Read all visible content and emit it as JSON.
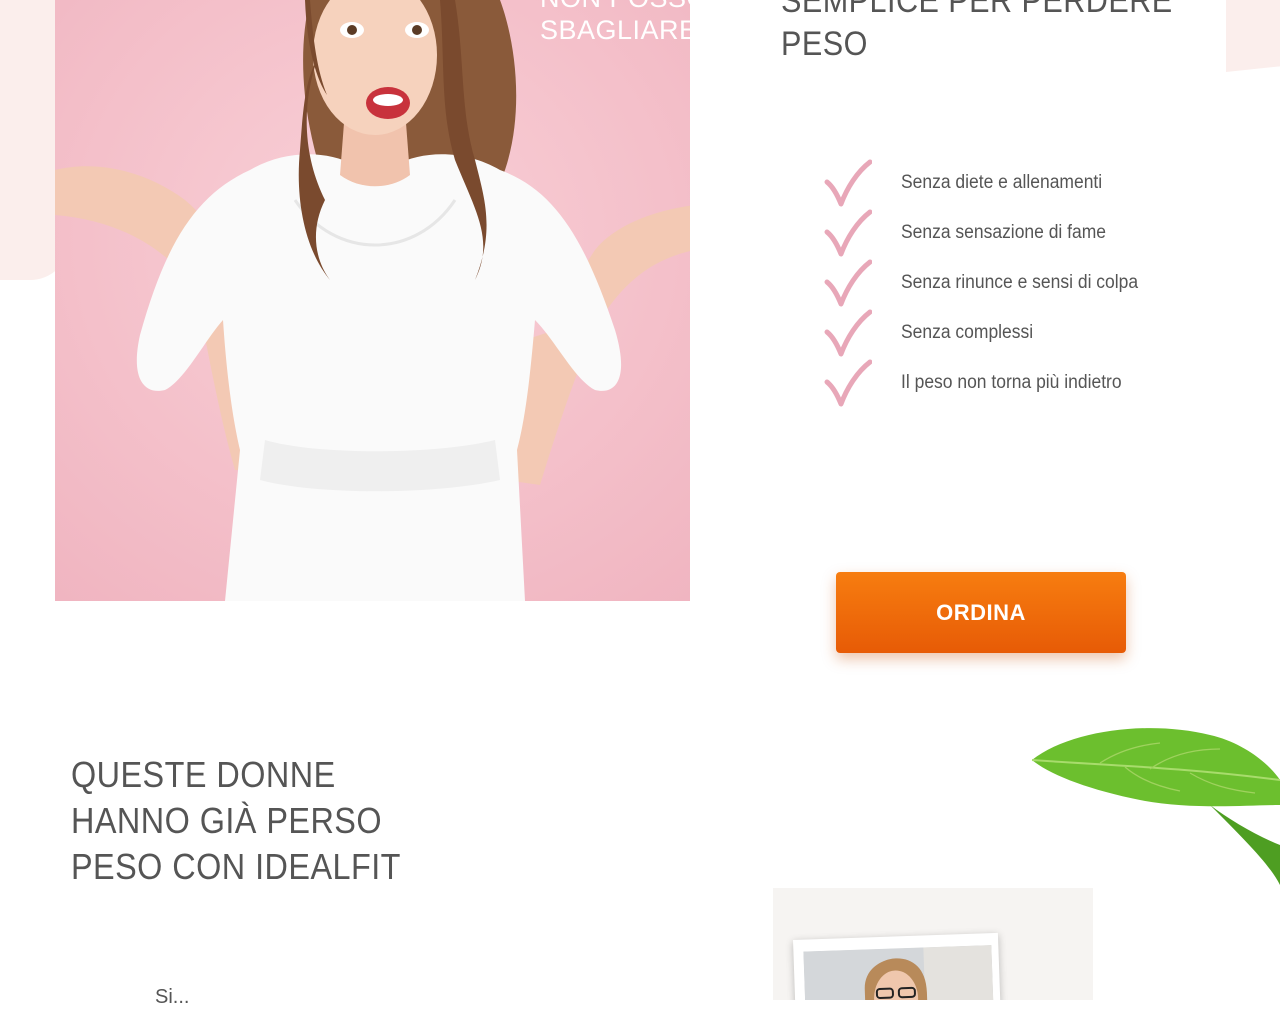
{
  "hero": {
    "overlay_line1": "NON POSSONO",
    "overlay_line2": "SBAGLIARE!"
  },
  "heading1": {
    "line1": "SEMPLICE PER PERDERE",
    "line2": "PESO"
  },
  "benefits": [
    {
      "label": "Senza diete e allenamenti",
      "icon": "check-icon"
    },
    {
      "label": "Senza sensazione di fame",
      "icon": "check-icon"
    },
    {
      "label": "Senza rinunce e sensi di colpa",
      "icon": "check-icon"
    },
    {
      "label": "Senza complessi",
      "icon": "check-icon"
    },
    {
      "label": "Il peso non torna più indietro",
      "icon": "check-icon"
    }
  ],
  "order_button": {
    "label": "ORDINA"
  },
  "heading2": {
    "line1": "QUESTE DONNE",
    "line2": "HANNO GIÀ PERSO",
    "line3": "PESO CON IDEALFIT"
  },
  "testimonial": {
    "partial_text": "Si..."
  },
  "colors": {
    "accent_pink": "#e8a7b8",
    "button_orange": "#f3720c",
    "heading_gray": "#555555",
    "hero_bg_pink": "#f4c2cb"
  }
}
